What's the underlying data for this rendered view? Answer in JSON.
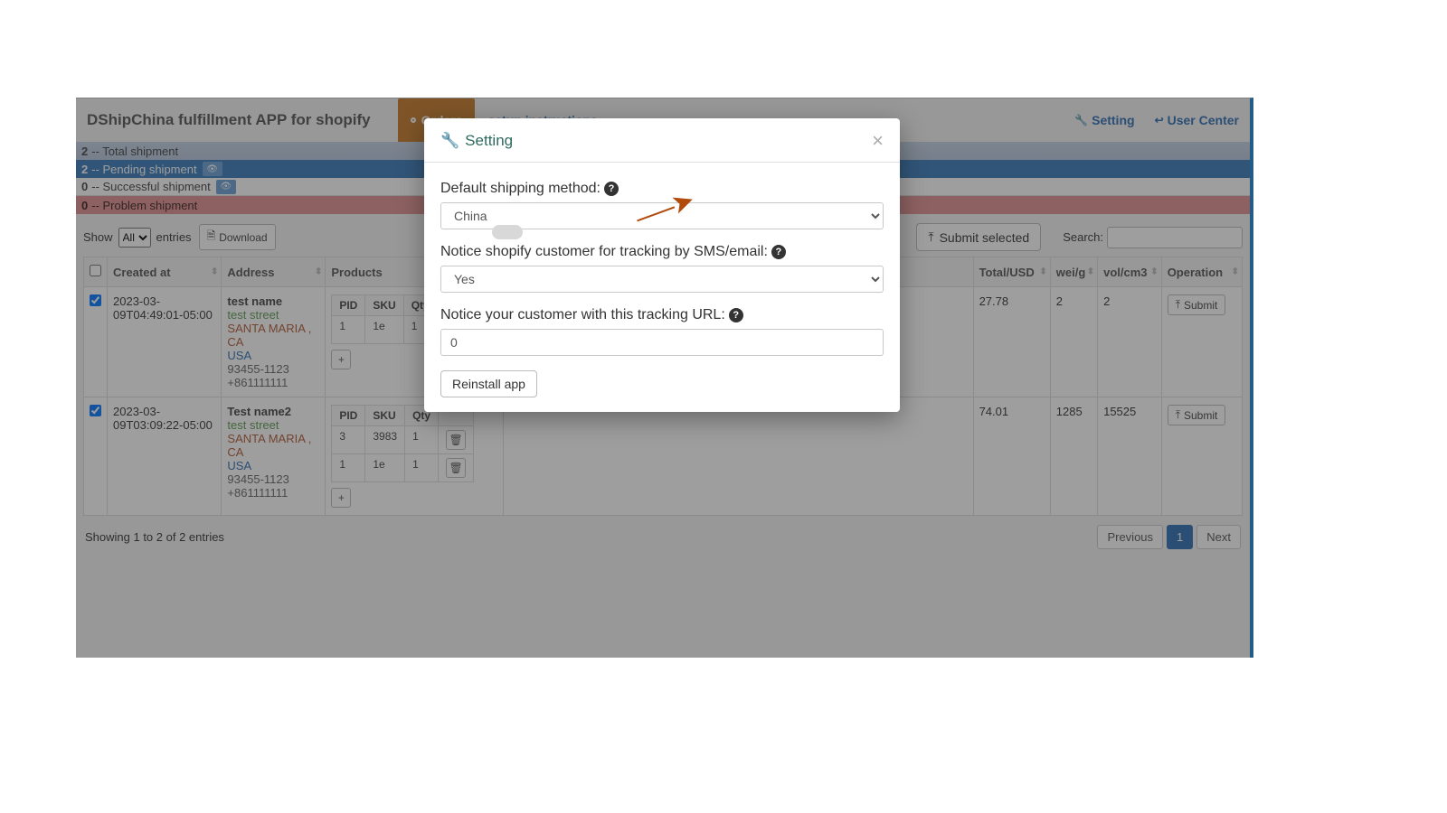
{
  "app": {
    "title": "DShipChina fulfillment APP for shopify"
  },
  "tabs": {
    "orders": "Orders",
    "setup": "setup instructions"
  },
  "topnav": {
    "setting": "Setting",
    "user_center": "User Center"
  },
  "status": {
    "total": {
      "n": "2",
      "label": " -- Total shipment"
    },
    "pending": {
      "n": "2",
      "label": " -- Pending shipment"
    },
    "success": {
      "n": "0",
      "label": " -- Successful shipment"
    },
    "problem": {
      "n": "0",
      "label": " -- Problem shipment"
    }
  },
  "controls": {
    "show": "Show",
    "all": "All",
    "entries": "entries",
    "download": "Download",
    "submit_selected": "Submit selected",
    "search": "Search:"
  },
  "cols": {
    "created": "Created at",
    "address": "Address",
    "products": "Products",
    "total": "Total/USD",
    "wei": "wei/g",
    "vol": "vol/cm3",
    "operation": "Operation"
  },
  "prod_cols": {
    "pid": "PID",
    "sku": "SKU",
    "qty": "Qty"
  },
  "rows": [
    {
      "created": "2023-03-09T04:49:01-05:00",
      "name": "test name",
      "street": "test street",
      "city": "SANTA MARIA , CA",
      "country": "USA",
      "zip": "93455-1123",
      "phone": "+861111111",
      "total": "27.78",
      "wei": "2",
      "vol": "2",
      "products": [
        {
          "pid": "1",
          "sku": "1e",
          "qty": "1"
        }
      ]
    },
    {
      "created": "2023-03-09T03:09:22-05:00",
      "name": "Test name2",
      "street": "test street",
      "city": "SANTA MARIA , CA",
      "country": "USA",
      "zip": "93455-1123",
      "phone": "+861111111",
      "total": "74.01",
      "wei": "1285",
      "vol": "15525",
      "products": [
        {
          "pid": "3",
          "sku": "3983",
          "qty": "1"
        },
        {
          "pid": "1",
          "sku": "1e",
          "qty": "1"
        }
      ]
    }
  ],
  "buttons": {
    "submit": "Submit"
  },
  "footer": {
    "info": "Showing 1 to 2 of 2 entries",
    "prev": "Previous",
    "page": "1",
    "next": "Next"
  },
  "modal": {
    "title": "Setting",
    "f1_label": "Default shipping method:",
    "f1_value": "China",
    "f2_label": "Notice shopify customer for tracking by SMS/email:",
    "f2_value": "Yes",
    "f3_label": "Notice your customer with this tracking URL:",
    "f3_value": "0",
    "reinstall": "Reinstall app"
  }
}
